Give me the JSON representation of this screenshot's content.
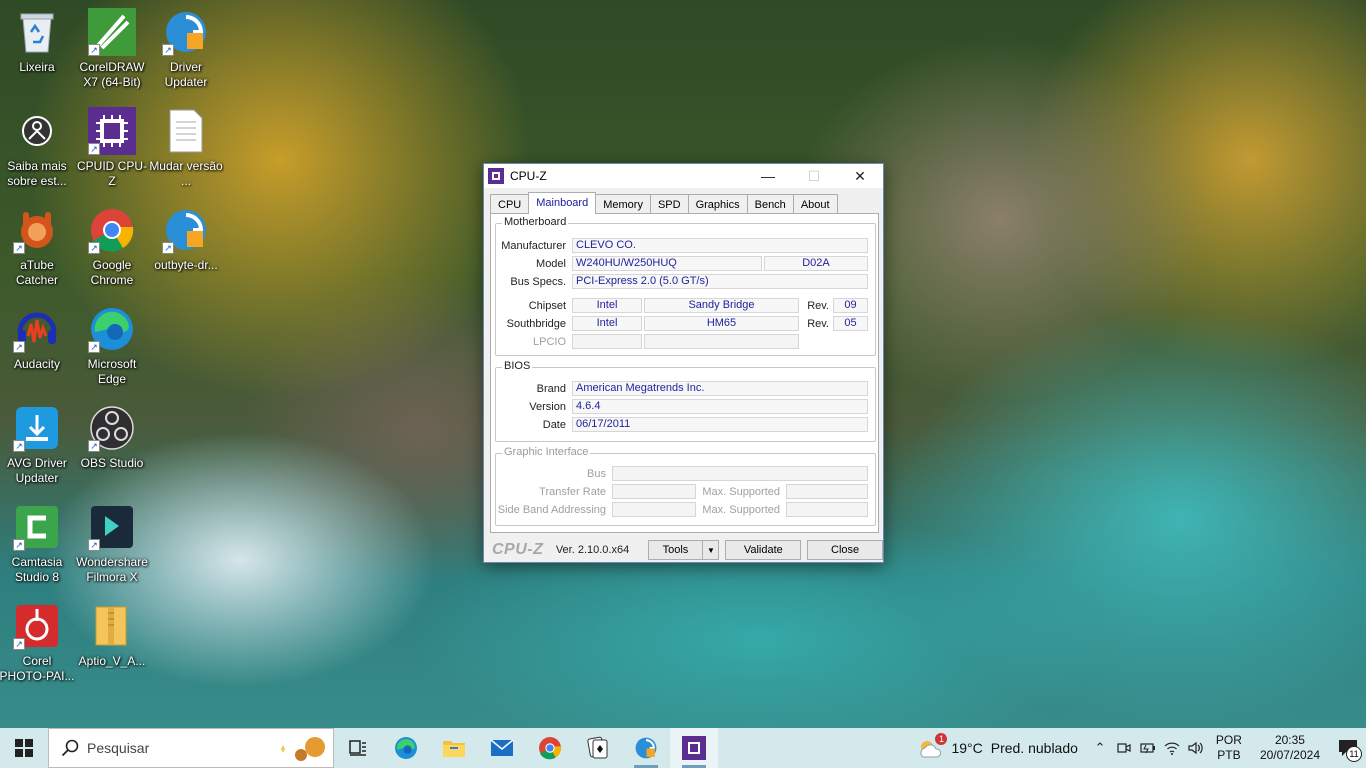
{
  "desktop": {
    "icons": [
      {
        "label": "Lixeira",
        "icon": "recycle-bin-icon"
      },
      {
        "label": "CorelDRAW X7 (64-Bit)",
        "icon": "coreldraw-icon"
      },
      {
        "label": "Driver Updater",
        "icon": "driver-updater-icon"
      },
      {
        "label": "Saiba mais sobre est...",
        "icon": "learn-more-icon"
      },
      {
        "label": "CPUID CPU-Z",
        "icon": "cpuz-icon"
      },
      {
        "label": "Mudar versão ...",
        "icon": "text-file-icon"
      },
      {
        "label": "aTube Catcher",
        "icon": "atube-catcher-icon"
      },
      {
        "label": "Google Chrome",
        "icon": "chrome-icon"
      },
      {
        "label": "outbyte-dr...",
        "icon": "outbyte-icon"
      },
      {
        "label": "Audacity",
        "icon": "audacity-icon"
      },
      {
        "label": "Microsoft Edge",
        "icon": "edge-icon"
      },
      {
        "label": "AVG Driver Updater",
        "icon": "avg-driver-updater-icon"
      },
      {
        "label": "OBS Studio",
        "icon": "obs-icon"
      },
      {
        "label": "Camtasia Studio 8",
        "icon": "camtasia-icon"
      },
      {
        "label": "Wondershare Filmora X",
        "icon": "filmora-icon"
      },
      {
        "label": "Corel PHOTO-PAI...",
        "icon": "corel-photo-paint-icon"
      },
      {
        "label": "Aptio_V_A...",
        "icon": "folder-icon"
      }
    ]
  },
  "window": {
    "title": "CPU-Z",
    "tabs": [
      "CPU",
      "Mainboard",
      "Memory",
      "SPD",
      "Graphics",
      "Bench",
      "About"
    ],
    "active_tab": "Mainboard",
    "motherboard": {
      "group_title": "Motherboard",
      "manufacturer_label": "Manufacturer",
      "manufacturer": "CLEVO CO.",
      "model_label": "Model",
      "model": "W240HU/W250HUQ",
      "model_rev": "D02A",
      "busspecs_label": "Bus Specs.",
      "busspecs": "PCI-Express 2.0 (5.0 GT/s)",
      "chipset_label": "Chipset",
      "chipset_vendor": "Intel",
      "chipset_name": "Sandy Bridge",
      "chipset_rev_label": "Rev.",
      "chipset_rev": "09",
      "southbridge_label": "Southbridge",
      "southbridge_vendor": "Intel",
      "southbridge_name": "HM65",
      "southbridge_rev_label": "Rev.",
      "southbridge_rev": "05",
      "lpcio_label": "LPCIO"
    },
    "bios": {
      "group_title": "BIOS",
      "brand_label": "Brand",
      "brand": "American Megatrends Inc.",
      "version_label": "Version",
      "version": "4.6.4",
      "date_label": "Date",
      "date": "06/17/2011"
    },
    "graphic_interface": {
      "group_title": "Graphic Interface",
      "bus_label": "Bus",
      "transfer_rate_label": "Transfer Rate",
      "max_supported_label_1": "Max. Supported",
      "sideband_label": "Side Band Addressing",
      "max_supported_label_2": "Max. Supported"
    },
    "footer": {
      "logo": "CPU-Z",
      "version": "Ver. 2.10.0.x64",
      "tools_label": "Tools",
      "validate_label": "Validate",
      "close_label": "Close"
    }
  },
  "taskbar": {
    "search_placeholder": "Pesquisar",
    "apps": [
      "task-view-icon",
      "edge-icon",
      "file-explorer-icon",
      "mail-icon",
      "chrome-icon",
      "solitaire-icon",
      "driver-updater-icon",
      "cpuz-icon"
    ],
    "weather": {
      "badge": "1",
      "temp": "19°C",
      "desc": "Pred. nublado"
    },
    "lang_line1": "POR",
    "lang_line2": "PTB",
    "time": "20:35",
    "date": "20/07/2024",
    "notification_count": "11"
  },
  "colors": {
    "value_text": "#1f1f9e",
    "taskbar_bg": "#d3e9ec",
    "window_border": "#6a88b4"
  }
}
